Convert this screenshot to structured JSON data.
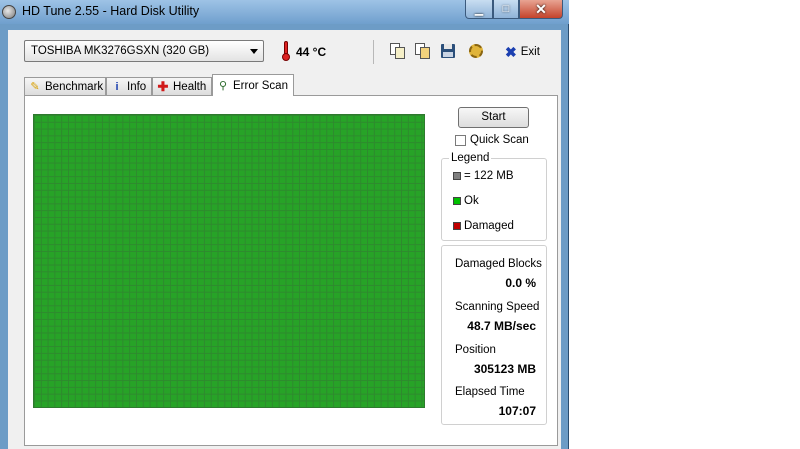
{
  "window": {
    "title": "HD Tune 2.55 - Hard Disk Utility"
  },
  "toolbar": {
    "drive": "TOSHIBA MK3276GSXN (320 GB)",
    "temperature": "44 °C",
    "exit_label": "Exit"
  },
  "tabs": [
    {
      "label": "Benchmark",
      "icon": "benchmark-icon"
    },
    {
      "label": "Info",
      "icon": "info-icon"
    },
    {
      "label": "Health",
      "icon": "health-icon"
    },
    {
      "label": "Error Scan",
      "icon": "magnifier-icon",
      "active": true
    }
  ],
  "scan": {
    "start_label": "Start",
    "quick_scan_label": "Quick Scan",
    "quick_scan_checked": false
  },
  "legend": {
    "title": "Legend",
    "block_size": "= 122 MB",
    "ok": "Ok",
    "damaged": "Damaged",
    "colors": {
      "block": "#808080",
      "ok": "#00c000",
      "damaged": "#c00000"
    }
  },
  "stats": {
    "damaged_blocks_label": "Damaged Blocks",
    "damaged_blocks_value": "0.0 %",
    "speed_label": "Scanning Speed",
    "speed_value": "48.7 MB/sec",
    "position_label": "Position",
    "position_value": "305123 MB",
    "elapsed_label": "Elapsed Time",
    "elapsed_value": "107:07"
  }
}
